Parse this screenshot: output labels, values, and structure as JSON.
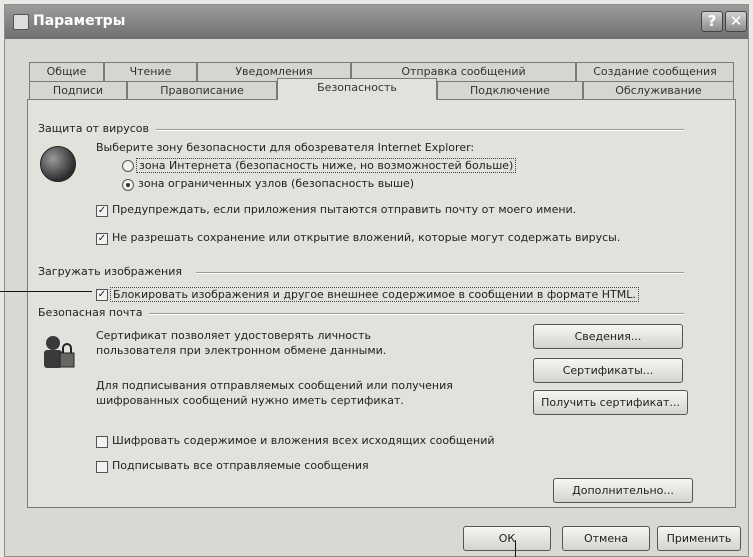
{
  "window": {
    "title": "Параметры"
  },
  "titlebar": {
    "help_label": "?",
    "close_label": "✕"
  },
  "tabs_row1": [
    "Общие",
    "Чтение",
    "Уведомления",
    "Отправка сообщений",
    "Создание сообщения"
  ],
  "tabs_row2": [
    "Подписи",
    "Правописание",
    "Безопасность",
    "Подключение",
    "Обслуживание"
  ],
  "active_tab": "Безопасность",
  "virus": {
    "section": "Защита от вирусов",
    "zone_prompt": "Выберите зону безопасности для обозревателя Internet Explorer:",
    "zone_internet": "зона Интернета (безопасность ниже, но возможностей больше)",
    "zone_restricted": "зона ограниченных узлов (безопасность выше)",
    "selected_zone": "restricted",
    "warn_label": "Предупреждать, если приложения пытаются отправить почту от моего имени.",
    "warn_checked": true,
    "block_attach_label": "Не разрешать сохранение или открытие вложений, которые могут содержать вирусы.",
    "block_attach_checked": true
  },
  "images": {
    "section": "Загружать изображения",
    "block_label": "Блокировать изображения и другое внешнее содержимое в сообщении в формате HTML.",
    "block_checked": true
  },
  "secure": {
    "section": "Безопасная почта",
    "cert_text_1": "Сертификат позволяет удостоверять личность",
    "cert_text_2": "пользователя при электронном обмене данными.",
    "details_button": "Сведения...",
    "certs_button": "Сертификаты...",
    "sign_text_1": "Для подписывания отправляемых сообщений или получения",
    "sign_text_2": "шифрованных сообщений нужно иметь сертификат.",
    "get_cert_button": "Получить сертификат...",
    "encrypt_label": "Шифровать содержимое и вложения всех исходящих сообщений",
    "encrypt_checked": false,
    "sign_label": "Подписывать все отправляемые сообщения",
    "sign_checked": false,
    "advanced_button": "Дополнительно..."
  },
  "footer": {
    "ok": "ОК",
    "cancel": "Отмена",
    "apply": "Применить"
  },
  "check_mark": "✓"
}
